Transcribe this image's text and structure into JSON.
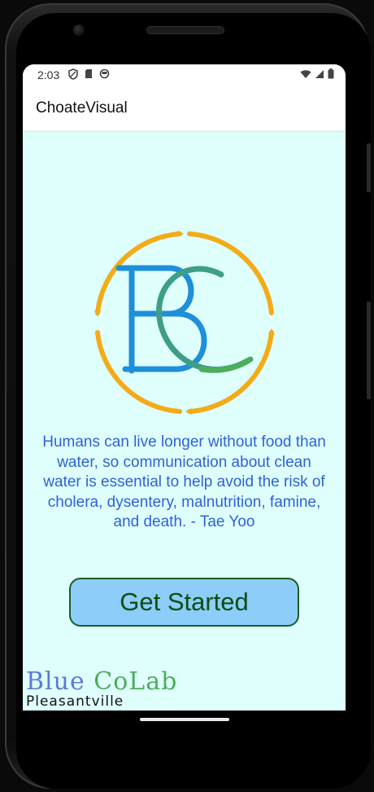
{
  "status_bar": {
    "time": "2:03",
    "left_icons": [
      "shield-icon",
      "sd-card-icon",
      "circle-face-icon"
    ],
    "right_icons": [
      "wifi-icon",
      "cellular-signal-icon",
      "battery-icon"
    ]
  },
  "app_bar": {
    "title": "ChoateVisual"
  },
  "logo": {
    "name": "bc-logo",
    "colors": {
      "ring": "#f4ab18",
      "letter_b": "#1e8fd8",
      "letter_c": "#3f9e86"
    }
  },
  "quote": {
    "text": "Humans can live longer without food than water, so communication about clean water is essential to help avoid the risk of cholera, dysentery, malnutrition, famine, and death. - Tae Yoo"
  },
  "cta": {
    "label": "Get Started"
  },
  "footer": {
    "brand_blue": "Blue",
    "brand_green": "CoLab",
    "brand_sub": "Pleasantville"
  },
  "theme": {
    "screen_background": "#dffffd",
    "quote_color": "#2f62d6",
    "button_background": "#8ccdf9",
    "button_border": "#1b5e20"
  }
}
